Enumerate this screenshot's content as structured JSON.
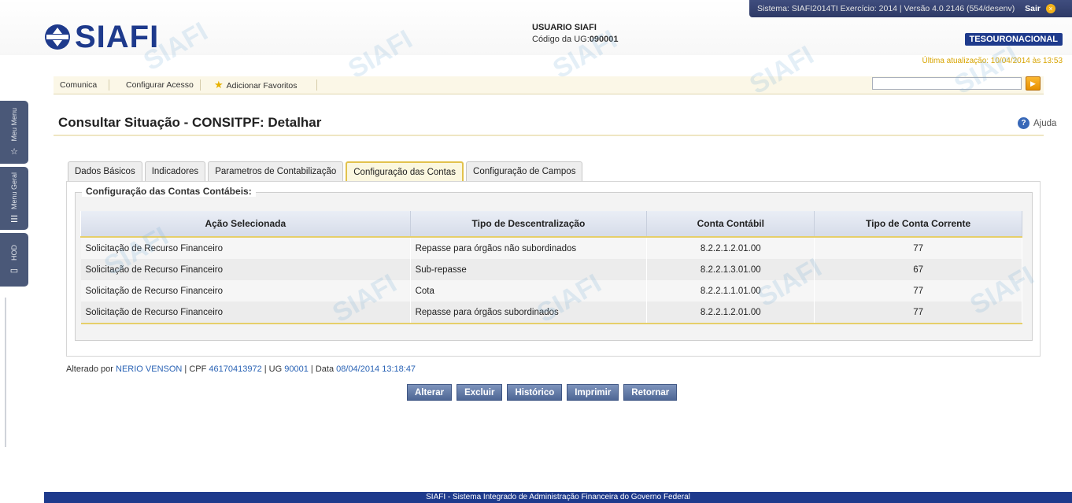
{
  "system": {
    "info": "Sistema: SIAFI2014TI Exercício: 2014 | Versão 4.0.2146 (554/desenv)",
    "sair": "Sair"
  },
  "brand": {
    "logo": "SIAFI",
    "tesouro": "TESOURONACIONAL",
    "footer": "SIAFI - Sistema Integrado de Administração Financeira do Governo Federal"
  },
  "user": {
    "title": "USUARIO SIAFI",
    "ug_label": "Código da UG:",
    "ug_value": "090001"
  },
  "last_update": "Última atualização: 10/04/2014 às 13:53",
  "side_tabs": [
    "Meu Menu",
    "Menu Geral",
    "HOD"
  ],
  "menu": {
    "comunica": "Comunica",
    "configurar": "Configurar Acesso",
    "favoritos": "Adicionar Favoritos"
  },
  "page": {
    "title": "Consultar Situação - CONSITPF: Detalhar",
    "help": "Ajuda"
  },
  "tabs": [
    "Dados Básicos",
    "Indicadores",
    "Parametros de Contabilização",
    "Configuração das Contas",
    "Configuração de Campos"
  ],
  "active_tab": "Configuração das Contas",
  "section": {
    "legend": "Configuração das Contas Contábeis:"
  },
  "table": {
    "headers": [
      "Ação Selecionada",
      "Tipo de Descentralização",
      "Conta Contábil",
      "Tipo de Conta Corrente"
    ],
    "rows": [
      [
        "Solicitação de Recurso Financeiro",
        "Repasse para órgãos não subordinados",
        "8.2.2.1.2.01.00",
        "77"
      ],
      [
        "Solicitação de Recurso Financeiro",
        "Sub-repasse",
        "8.2.2.1.3.01.00",
        "67"
      ],
      [
        "Solicitação de Recurso Financeiro",
        "Cota",
        "8.2.2.1.1.01.00",
        "77"
      ],
      [
        "Solicitação de Recurso Financeiro",
        "Repasse para órgãos subordinados",
        "8.2.2.1.2.01.00",
        "77"
      ]
    ]
  },
  "audit": {
    "alterado_por": "Alterado por",
    "nome": "NERIO VENSON",
    "cpf_label": "| CPF",
    "cpf": "46170413972",
    "ug_label": "| UG",
    "ug": "90001",
    "data_label": "| Data",
    "data": "08/04/2014 13:18:47"
  },
  "buttons": [
    "Alterar",
    "Excluir",
    "Histórico",
    "Imprimir",
    "Retornar"
  ],
  "colors": {
    "brand_blue": "#1e3a8c",
    "accent_yellow": "#e6cf6a",
    "button": "#5a719c"
  }
}
